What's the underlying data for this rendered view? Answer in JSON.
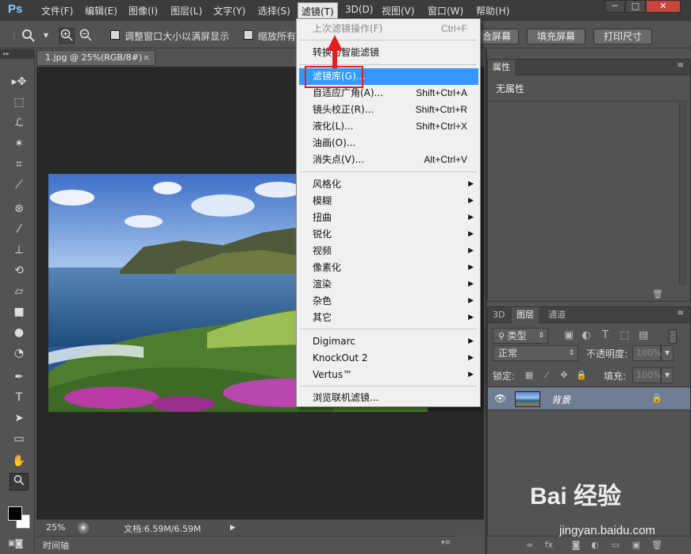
{
  "app": {
    "logo": "Ps"
  },
  "menubar": {
    "items": [
      "文件(F)",
      "编辑(E)",
      "图像(I)",
      "图层(L)",
      "文字(Y)",
      "选择(S)",
      "滤镜(T)",
      "3D(D)",
      "视图(V)",
      "窗口(W)",
      "帮助(H)"
    ],
    "active": "滤镜(T)",
    "window_controls": [
      "─",
      "□",
      "✕"
    ]
  },
  "options_bar": {
    "checkbox1_label": "调整窗口大小以满屏显示",
    "checkbox2_label": "缩放所有",
    "btn_fit": "合屏幕",
    "btn_fill": "填充屏幕",
    "btn_print": "打印尺寸"
  },
  "document": {
    "tab_title": "1.jpg @ 25%(RGB/8#)",
    "tab_close": "×",
    "zoom": "25%",
    "doc_info": "文档:6.59M/6.59M",
    "timeline_label": "时间轴"
  },
  "filter_menu": {
    "items": [
      {
        "label": "上次滤镜操作(F)",
        "shortcut": "Ctrl+F",
        "disabled": true
      },
      {
        "label": "转换为智能滤镜",
        "shortcut": ""
      },
      {
        "label": "滤镜库(G)...",
        "shortcut": "",
        "highlighted": true
      },
      {
        "label": "自适应广角(A)...",
        "shortcut": "Shift+Ctrl+A"
      },
      {
        "label": "镜头校正(R)...",
        "shortcut": "Shift+Ctrl+R"
      },
      {
        "label": "液化(L)...",
        "shortcut": "Shift+Ctrl+X"
      },
      {
        "label": "油画(O)...",
        "shortcut": ""
      },
      {
        "label": "消失点(V)...",
        "shortcut": "Alt+Ctrl+V"
      },
      {
        "label": "风格化",
        "submenu": true
      },
      {
        "label": "模糊",
        "submenu": true
      },
      {
        "label": "扭曲",
        "submenu": true
      },
      {
        "label": "锐化",
        "submenu": true
      },
      {
        "label": "视频",
        "submenu": true
      },
      {
        "label": "像素化",
        "submenu": true
      },
      {
        "label": "渲染",
        "submenu": true
      },
      {
        "label": "杂色",
        "submenu": true
      },
      {
        "label": "其它",
        "submenu": true
      },
      {
        "label": "Digimarc",
        "submenu": true
      },
      {
        "label": "KnockOut 2",
        "submenu": true
      },
      {
        "label": "Vertus™",
        "submenu": true
      },
      {
        "label": "浏览联机滤镜...",
        "shortcut": ""
      }
    ],
    "submenu_arrow": "▶"
  },
  "properties_panel": {
    "tab": "属性",
    "content": "无属性"
  },
  "layers_panel": {
    "tabs": [
      "3D",
      "图层",
      "通道"
    ],
    "active_tab": "图层",
    "filter_kind": "类型",
    "blend_mode": "正常",
    "opacity_label": "不透明度:",
    "opacity_value": "100%",
    "lock_label": "锁定:",
    "fill_label": "填充:",
    "fill_value": "100%",
    "layers": [
      {
        "name": "背景",
        "visible": true,
        "locked": true
      }
    ]
  },
  "watermark": {
    "brand": "Bai 经验",
    "url": "jingyan.baidu.com"
  }
}
